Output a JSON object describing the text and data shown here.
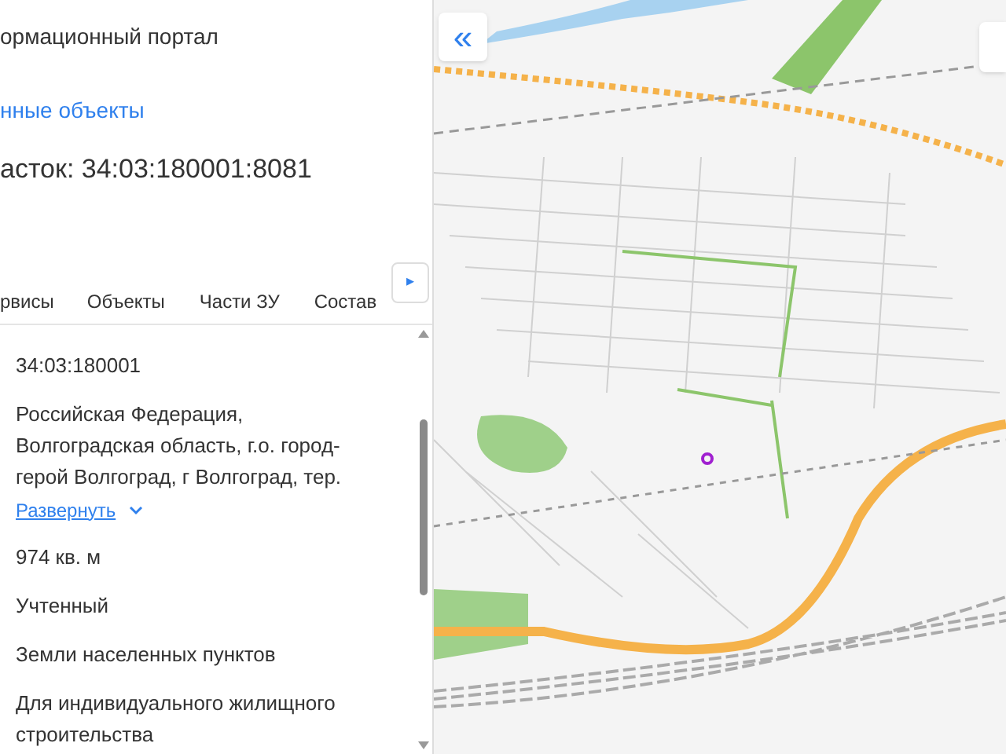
{
  "header": {
    "portal_title": "ормационный портал",
    "link": "нные объекты",
    "parcel_title": "асток: 34:03:180001:8081"
  },
  "tabs": [
    {
      "label": "рвисы"
    },
    {
      "label": "Объекты"
    },
    {
      "label": "Части ЗУ"
    },
    {
      "label": "Состав"
    }
  ],
  "tabs_next": "▸",
  "fields": [
    {
      "kind": "text",
      "value": "34:03:180001"
    },
    {
      "kind": "expandable",
      "value": "Российская Федерация, Волгоградская область, г.о. город-герой Волгоград, г Волгоград, тер.",
      "link": "Развернуть"
    },
    {
      "kind": "text",
      "value": "974 кв. м"
    },
    {
      "kind": "text",
      "value": "Учтенный"
    },
    {
      "kind": "text",
      "value": "Земли населенных пунктов"
    },
    {
      "kind": "text",
      "value": "Для индивидуального жилищного строительства"
    }
  ],
  "map": {
    "collapse_button": "«"
  }
}
